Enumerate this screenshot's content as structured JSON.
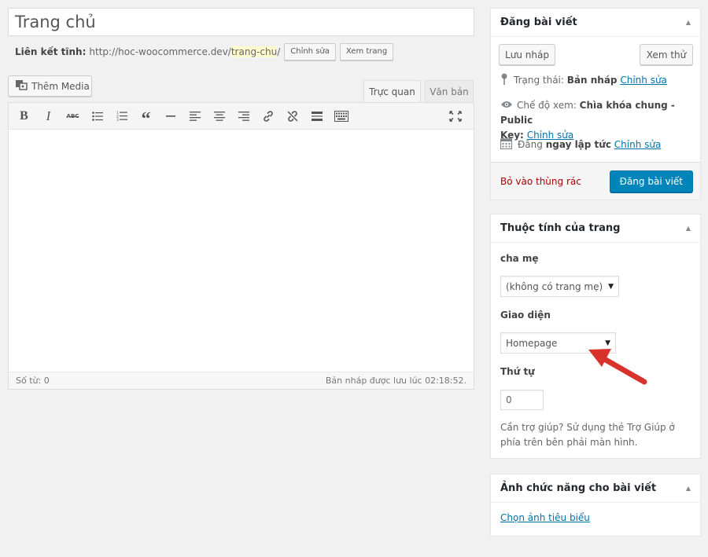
{
  "editor": {
    "title": "Trang chủ",
    "permalink": {
      "label": "Liên kết tĩnh:",
      "base_url": "http://hoc-woocommerce.dev/",
      "slug": "trang-chu",
      "suffix": "/",
      "edit_button": "Chỉnh sửa",
      "view_button": "Xem trang"
    },
    "add_media": "Thêm Media",
    "tabs": {
      "visual": "Trực quan",
      "text": "Văn bản"
    },
    "word_count": "Số từ: 0",
    "draft_saved": "Bản nháp được lưu lúc 02:18:52.",
    "toolbar_icons": [
      "bold-icon",
      "italic-icon",
      "strikethrough-icon",
      "bullet-list-icon",
      "numbered-list-icon",
      "blockquote-icon",
      "horizontal-rule-icon",
      "align-left-icon",
      "align-center-icon",
      "align-right-icon",
      "link-icon",
      "unlink-icon",
      "read-more-icon",
      "toolbar-toggle-icon",
      "fullscreen-icon"
    ]
  },
  "publish_box": {
    "title": "Đăng bài viết",
    "save_draft": "Lưu nháp",
    "preview": "Xem thử",
    "status_label": "Trạng thái:",
    "status_value": "Bản nháp",
    "visibility_label": "Chế độ xem:",
    "visibility_value": "Chìa khóa chung - Public",
    "visibility_value2": "Key:",
    "publish_label": "Đăng",
    "publish_value": "ngay lập tức",
    "edit_link": "Chỉnh sửa",
    "trash": "Bỏ vào thùng rác",
    "publish_button": "Đăng bài viết"
  },
  "attributes_box": {
    "title": "Thuộc tính của trang",
    "parent_label": "cha mẹ",
    "parent_value": "(không có trang mẹ)",
    "template_label": "Giao diện",
    "template_value": "Homepage",
    "order_label": "Thứ tự",
    "order_value": "0",
    "help_text": "Cần trợ giúp? Sử dụng thẻ Trợ Giúp ở phía trên bên phải màn hình."
  },
  "featured_box": {
    "title": "Ảnh chức năng cho bài viết",
    "set_link": "Chọn ảnh tiêu biểu"
  },
  "colors": {
    "primary_button": "#0085ba",
    "link": "#0073aa",
    "trash": "#a00000",
    "annotation_arrow": "#d9312b"
  }
}
